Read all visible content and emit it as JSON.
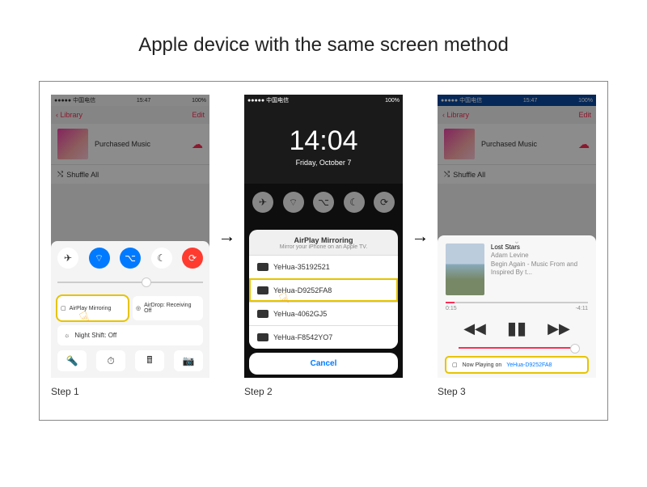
{
  "title": "Apple device with the same screen method",
  "steps": {
    "s1": "Step 1",
    "s2": "Step 2",
    "s3": "Step 3"
  },
  "statusbar": {
    "carrier": "●●●●● 中国电信",
    "time": "15:47",
    "batt": "100%"
  },
  "music": {
    "back": "Library",
    "edit": "Edit",
    "header": "Purchased Music",
    "shuffle": "Shuffle All"
  },
  "cc": {
    "airplay": "AirPlay Mirroring",
    "airdrop": "AirDrop: Receiving Off",
    "nightshift": "Night Shift: Off"
  },
  "lock": {
    "time": "14:04",
    "date": "Friday, October 7"
  },
  "sheet": {
    "title": "AirPlay Mirroring",
    "sub": "Mirror your iPhone on an Apple TV.",
    "devices": [
      "YeHua-35192521",
      "YeHua-D9252FA8",
      "YeHua-4062GJ5",
      "YeHua-F8542YO7"
    ],
    "cancel": "Cancel"
  },
  "np": {
    "track": "Lost Stars",
    "artist": "Adam Levine",
    "album": "Begin Again - Music From and Inspired By t...",
    "t0": "0:15",
    "t1": "-4:11",
    "bottom_pre": "Now Playing on",
    "bottom_dev": "YeHua-D9252FA8"
  }
}
